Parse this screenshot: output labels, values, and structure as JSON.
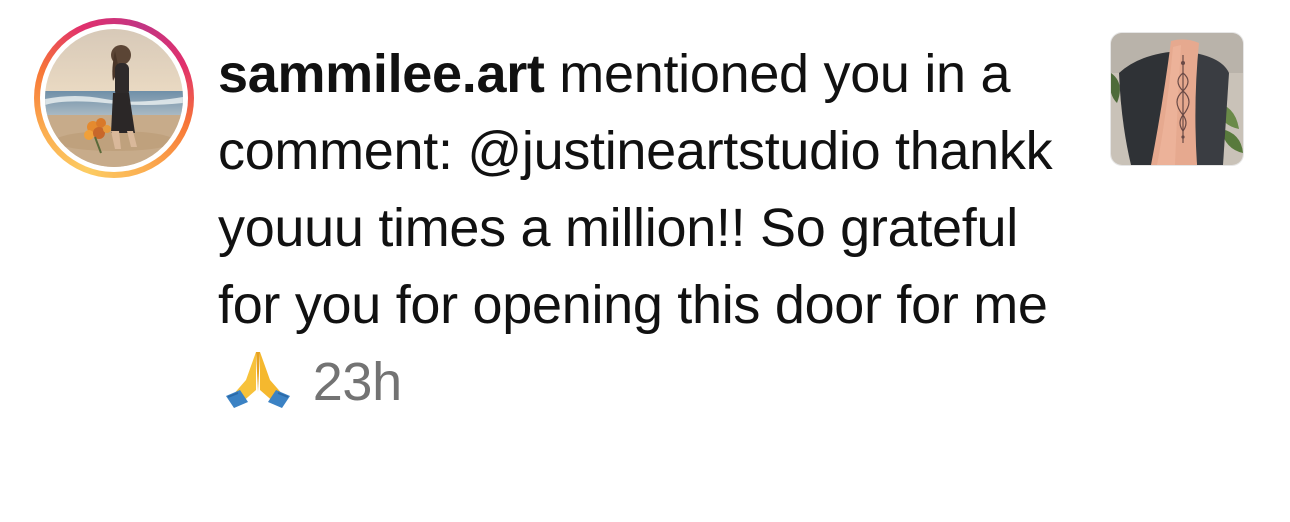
{
  "notification": {
    "username": "sammilee.art",
    "action_text": " mentioned you in a comment: ",
    "comment_text": "@justineartstudio thankk youuu times a million!! So grateful for you for opening this door for me",
    "emoji": "🙏",
    "timestamp": "23h"
  },
  "avatar": {
    "icon": "profile-photo",
    "ring_colors": [
      "#fccc63",
      "#f77737",
      "#e1306c",
      "#c13584"
    ]
  },
  "post_thumbnail": {
    "icon": "post-photo"
  },
  "colors": {
    "text": "#111111",
    "timestamp": "#737373",
    "background": "#ffffff"
  }
}
